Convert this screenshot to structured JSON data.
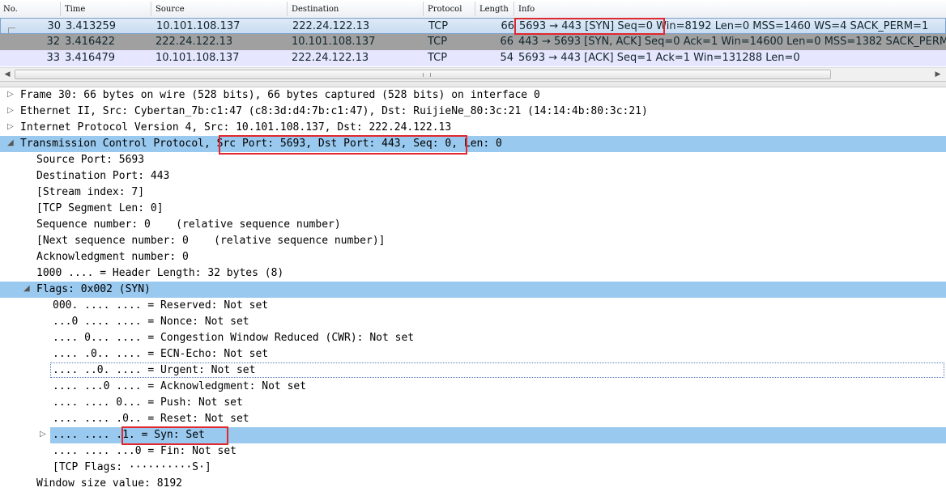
{
  "packet_list": {
    "columns": [
      "No.",
      "Time",
      "Source",
      "Destination",
      "Protocol",
      "Length",
      "Info"
    ],
    "rows": [
      {
        "no": "30",
        "time": "3.413259",
        "source": "10.101.108.137",
        "destination": "222.24.122.13",
        "protocol": "TCP",
        "length": "66",
        "info_boxed": "5693 → 443 [SYN] Seq=0",
        "info_rest": " Win=8192 Len=0 MSS=1460 WS=4 SACK_PERM=1"
      },
      {
        "no": "32",
        "time": "3.416422",
        "source": "222.24.122.13",
        "destination": "10.101.108.137",
        "protocol": "TCP",
        "length": "66",
        "info": "443 → 5693 [SYN, ACK] Seq=0 Ack=1 Win=14600 Len=0 MSS=1382 SACK_PERM=1"
      },
      {
        "no": "33",
        "time": "3.416479",
        "source": "10.101.108.137",
        "destination": "222.24.122.13",
        "protocol": "TCP",
        "length": "54",
        "info": "5693 → 443 [ACK] Seq=1 Ack=1 Win=131288 Len=0"
      }
    ]
  },
  "details": {
    "frame": "Frame 30: 66 bytes on wire (528 bits), 66 bytes captured (528 bits) on interface 0",
    "ethernet": "Ethernet II, Src: Cybertan_7b:c1:47 (c8:3d:d4:7b:c1:47), Dst: RuijieNe_80:3c:21 (14:14:4b:80:3c:21)",
    "ip": "Internet Protocol Version 4, Src: 10.101.108.137, Dst: 222.24.122.13",
    "tcp_prefix": "Transmission Control Protocol, ",
    "tcp_boxed": "Src Port: 5693, Dst Port: 443, Seq: 0",
    "tcp_suffix": ", Len: 0",
    "tcp_fields": [
      "Source Port: 5693",
      "Destination Port: 443",
      "[Stream index: 7]",
      "[TCP Segment Len: 0]",
      "Sequence number: 0    (relative sequence number)",
      "[Next sequence number: 0    (relative sequence number)]",
      "Acknowledgment number: 0",
      "1000 .... = Header Length: 32 bytes (8)"
    ],
    "flags": "Flags: 0x002 (SYN)",
    "flag_bits": [
      "000. .... .... = Reserved: Not set",
      "...0 .... .... = Nonce: Not set",
      ".... 0... .... = Congestion Window Reduced (CWR): Not set",
      ".... .0.. .... = ECN-Echo: Not set",
      ".... ..0. .... = Urgent: Not set",
      ".... ...0 .... = Acknowledgment: Not set",
      ".... .... 0... = Push: Not set",
      ".... .... .0.. = Reset: Not set"
    ],
    "syn_prefix": ".... .... ",
    "syn_boxed": ".1. = Syn: Set",
    "fin": ".... .... ...0 = Fin: Not set",
    "tcp_flags": "[TCP Flags: ··········S·]",
    "window": "Window size value: 8192"
  },
  "colors": {
    "selected_row": "#c8dcf1",
    "gray_row": "#a0a0a0",
    "lavender_row": "#e7e6ff",
    "tree_highlight": "#99c9ef",
    "annotation_box": "#e0282e"
  }
}
